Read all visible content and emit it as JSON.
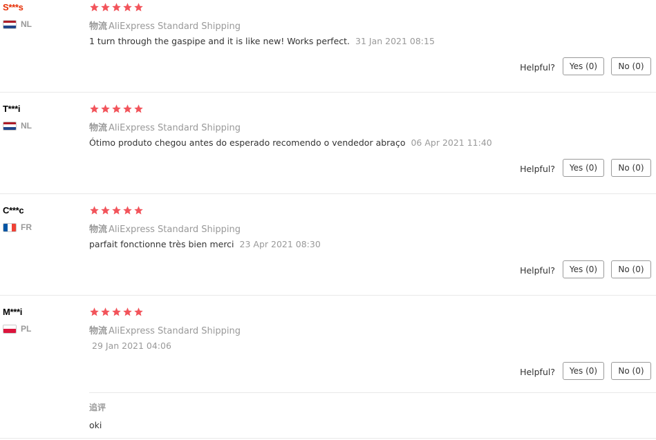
{
  "colors": {
    "star": "#f2545b",
    "username_highlight": "#e62e04",
    "muted": "#999999",
    "text": "#333333"
  },
  "helpful_label": "Helpful?",
  "reviews": [
    {
      "user": "S***s",
      "country": "NL",
      "flag": "netherlands",
      "stars": 5,
      "logistics_label": "物流",
      "logistics": "AliExpress Standard Shipping",
      "text": "1 turn through the gaspipe and it is like new! Works perfect.",
      "date": "31 Jan 2021 08:15",
      "yes": "Yes (0)",
      "no": "No (0)"
    },
    {
      "user": "T***i",
      "country": "NL",
      "flag": "netherlands",
      "stars": 5,
      "logistics_label": "物流",
      "logistics": "AliExpress Standard Shipping",
      "text": "Ótimo produto chegou antes do esperado recomendo o vendedor abraço",
      "date": "06 Apr 2021 11:40",
      "yes": "Yes (0)",
      "no": "No (0)"
    },
    {
      "user": "C***c",
      "country": "FR",
      "flag": "france",
      "stars": 5,
      "logistics_label": "物流",
      "logistics": "AliExpress Standard Shipping",
      "text": "parfait fonctionne très bien merci",
      "date": "23 Apr 2021 08:30",
      "yes": "Yes (0)",
      "no": "No (0)"
    },
    {
      "user": "M***i",
      "country": "PL",
      "flag": "poland",
      "stars": 5,
      "logistics_label": "物流",
      "logistics": "AliExpress Standard Shipping",
      "text": "",
      "date": "29 Jan 2021 04:06",
      "yes": "Yes (0)",
      "no": "No (0)",
      "followup_label": "追评",
      "followup_text": "oki"
    }
  ]
}
